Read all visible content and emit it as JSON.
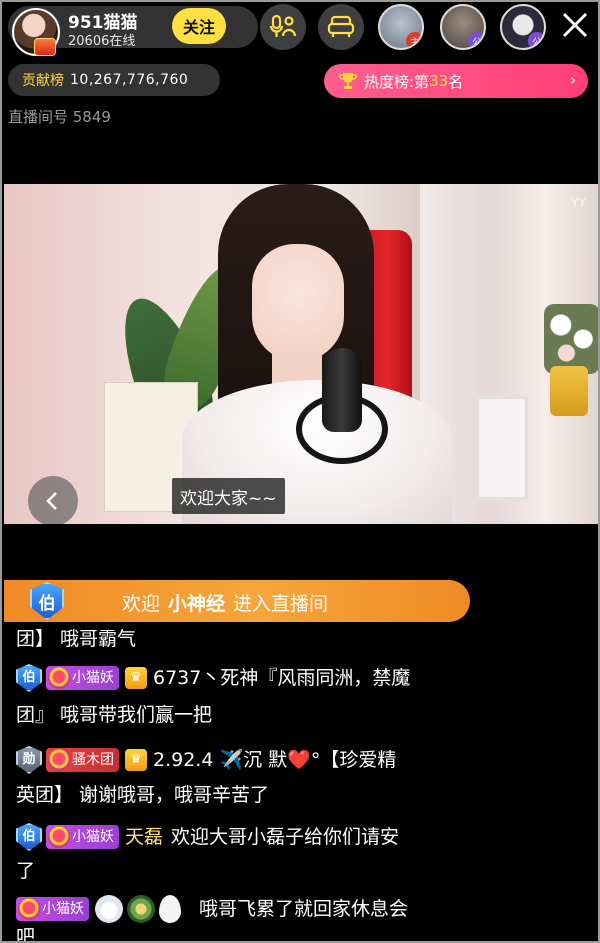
{
  "header": {
    "host_name": "951猫猫",
    "viewer_count": "20606在线",
    "follow_label": "关注",
    "viewer_badges": [
      "主",
      "公",
      "公"
    ],
    "close_icon": "close-icon"
  },
  "stats": {
    "contribution_label": "贡献榜",
    "contribution_value": "10,267,776,760",
    "rank_prefix": "热度榜:第",
    "rank_number": "33",
    "rank_suffix": "名",
    "room_id": "直播间号 5849"
  },
  "video": {
    "watermark": "YY",
    "subtitle": "欢迎大家~~"
  },
  "welcome": {
    "badge": "伯",
    "prefix": "欢迎",
    "user": "小神经",
    "suffix": "进入直播间"
  },
  "chat": [
    {
      "text": "团】 哦哥霸气"
    },
    {
      "badge": "伯",
      "fan_badge": "小猫妖",
      "text": "6737丶死神『风雨同洲，禁魔"
    },
    {
      "text": "团』 哦哥带我们赢一把"
    },
    {
      "badge": "勋",
      "fan_badge": "骚木团",
      "text": "2.92.4 ✈️沉 默❤️°【珍爱精"
    },
    {
      "text": "英团】 谢谢哦哥，哦哥辛苦了"
    },
    {
      "badge": "伯",
      "fan_badge": "小猫妖",
      "username": "天磊",
      "text": "欢迎大哥小磊子给你们请安"
    },
    {
      "text": "了"
    },
    {
      "fan_badge": "小猫妖",
      "text": "哦哥飞累了就回家休息会"
    },
    {
      "text": "吧"
    }
  ],
  "colors": {
    "follow_yellow": "#ffe040",
    "rank_pink": "#ff4f80",
    "banner_orange": "#f39330",
    "contrib_gold": "#ffd640"
  }
}
